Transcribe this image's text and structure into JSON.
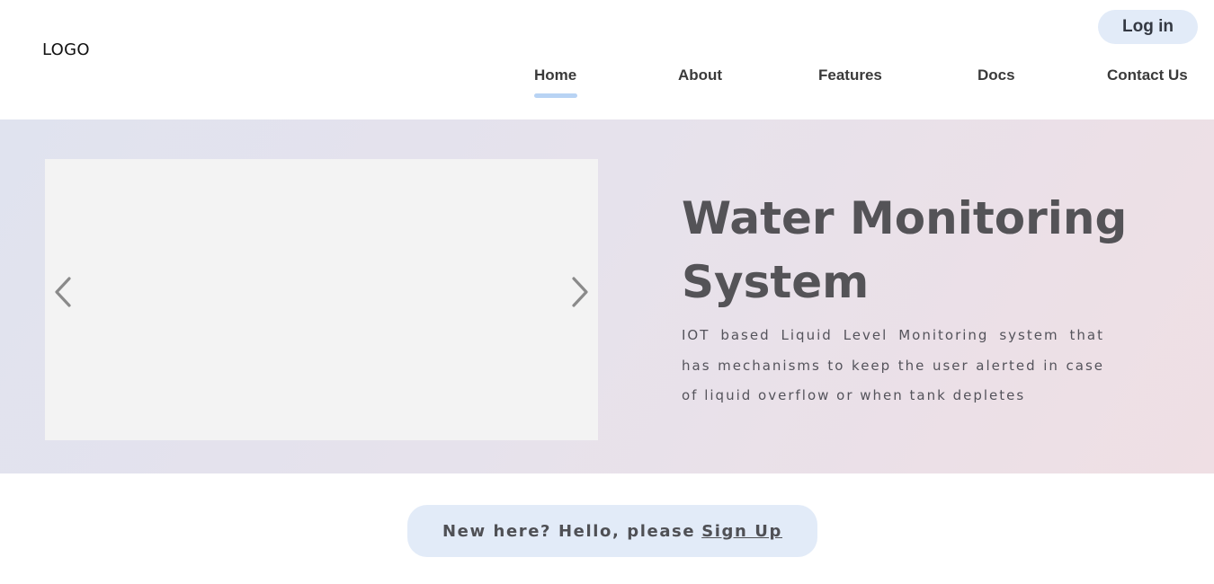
{
  "header": {
    "logo": "LOGO",
    "login_label": "Log in",
    "nav": [
      {
        "label": "Home",
        "active": true
      },
      {
        "label": "About",
        "active": false
      },
      {
        "label": "Features",
        "active": false
      },
      {
        "label": "Docs",
        "active": false
      },
      {
        "label": "Contact Us",
        "active": false
      }
    ]
  },
  "hero": {
    "title": "Water Monitoring System",
    "description": "IOT based Liquid Level Monitoring system that has mechanisms to keep the user alerted in case of liquid overflow or when tank depletes",
    "slider": {
      "prev_icon": "chevron-left-icon",
      "next_icon": "chevron-right-icon"
    }
  },
  "signup": {
    "prompt": "New here? Hello, please",
    "link_label": "Sign Up"
  },
  "colors": {
    "accent_pill": "#e2ebf8",
    "active_underline": "#b8d3f4",
    "title_text": "#545357",
    "hero_gradient_start": "#e0e3ef",
    "hero_gradient_end": "#efdfe4"
  }
}
